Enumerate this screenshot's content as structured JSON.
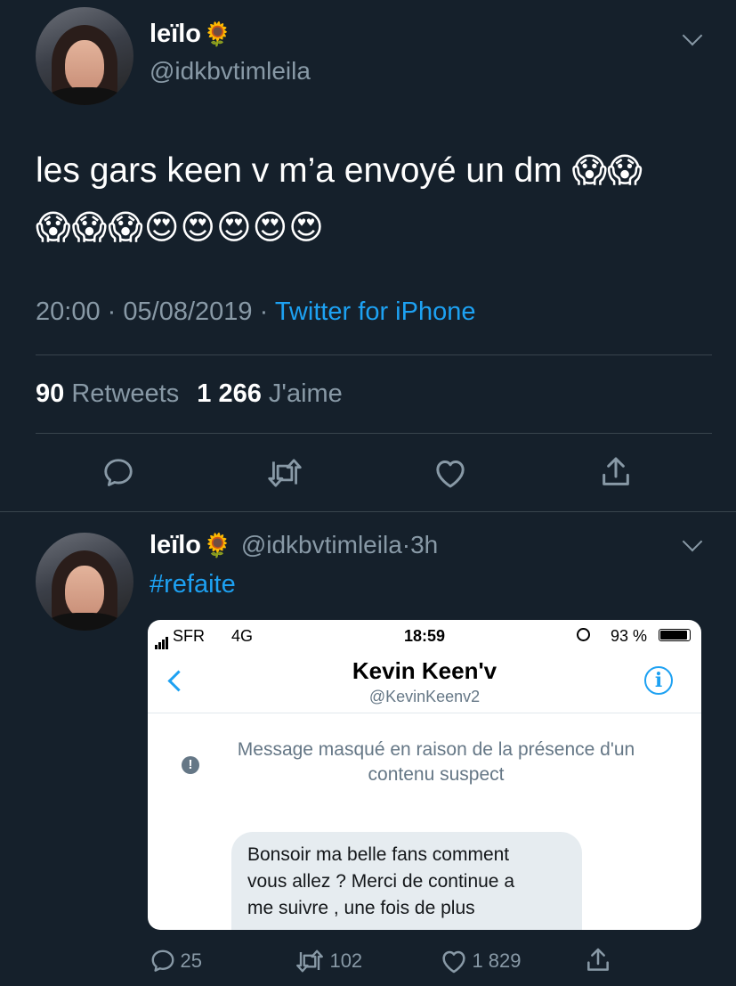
{
  "main_tweet": {
    "display_name": "leïlo",
    "name_emoji": "🌻",
    "handle": "@idkbvtimleila",
    "text_line1": "les gars keen v m’a envoyé un dm",
    "emojis_line1": "😱😱",
    "emojis_line2": "😱😱😱😍😍😍😍😍",
    "time": "20:00",
    "date": "05/08/2019",
    "separator": "·",
    "source": "Twitter for iPhone",
    "retweets_count": "90",
    "retweets_label": "Retweets",
    "likes_count": "1 266",
    "likes_label": "J'aime",
    "actions": {
      "reply_icon": "reply-icon",
      "retweet_icon": "retweet-icon",
      "like_icon": "heart-icon",
      "share_icon": "share-icon"
    }
  },
  "reply_tweet": {
    "display_name": "leïlo",
    "name_emoji": "🌻",
    "handle": "@idkbvtimleila",
    "separator": "·",
    "time_ago": "3h",
    "hashtag": "#refaite",
    "reply_count": "25",
    "retweet_count": "102",
    "like_count": "1 829"
  },
  "screenshot": {
    "carrier": "SFR",
    "network": "4G",
    "clock": "18:59",
    "battery": "93 %",
    "contact_name": "Kevin Keen'v",
    "contact_handle": "@KevinKeenv2",
    "hidden_notice": "Message masqué en raison de la présence d'un contenu suspect",
    "message_line1": "Bonsoir ma belle fans comment",
    "message_line2": "vous allez ? Merci de continue a",
    "message_line3": "me suivre , une fois de plus"
  },
  "colors": {
    "background": "#15202b",
    "accent": "#1da1f2",
    "secondary_text": "#8899a6",
    "divider": "#38444d"
  }
}
